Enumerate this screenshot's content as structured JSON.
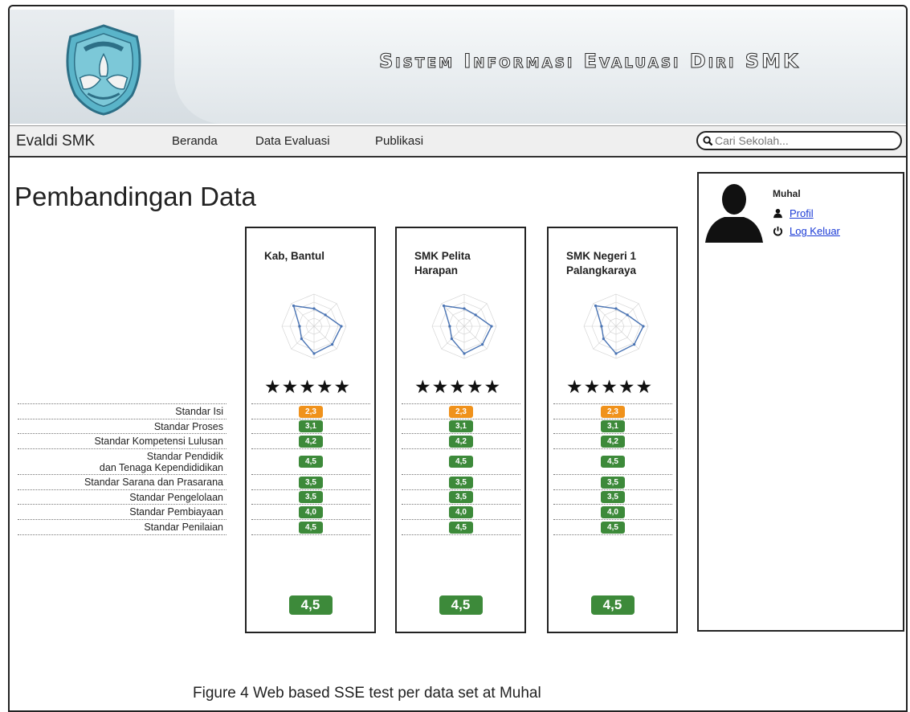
{
  "app": {
    "title": "Sistem Informasi Evaluasi Diri SMK",
    "brand": "Evaldi SMK"
  },
  "nav": {
    "items": [
      "Beranda",
      "Data Evaluasi",
      "Publikasi"
    ],
    "search_placeholder": "Cari Sekolah..."
  },
  "page": {
    "title": "Pembandingan Data"
  },
  "standards": [
    "Standar Isi",
    "Standar Proses",
    "Standar Kompetensi Lulusan",
    "Standar Pendidik\ndan Tenaga Kependididikan",
    "Standar Sarana dan Prasarana",
    "Standar Pengelolaan",
    "Standar Pembiayaan",
    "Standar Penilaian"
  ],
  "colors": {
    "orange": "#f0921c",
    "green": "#3d8a3a"
  },
  "columns": [
    {
      "name": "Kab, Bantul",
      "stars": "★★★★★",
      "scores": [
        "2,3",
        "3,1",
        "4,2",
        "4,5",
        "3,5",
        "3,5",
        "4,0",
        "4,5"
      ],
      "score_colors": [
        "orange",
        "green",
        "green",
        "green",
        "green",
        "green",
        "green",
        "green"
      ],
      "total": "4,5"
    },
    {
      "name": "SMK Pelita Harapan",
      "stars": "★★★★★",
      "scores": [
        "2,3",
        "3,1",
        "4,2",
        "4,5",
        "3,5",
        "3,5",
        "4,0",
        "4,5"
      ],
      "score_colors": [
        "orange",
        "green",
        "green",
        "green",
        "green",
        "green",
        "green",
        "green"
      ],
      "total": "4,5"
    },
    {
      "name": "SMK Negeri 1 Palangkaraya",
      "stars": "★★★★★",
      "scores": [
        "2,3",
        "3,1",
        "4,2",
        "4,5",
        "3,5",
        "3,5",
        "4,0",
        "4,5"
      ],
      "score_colors": [
        "orange",
        "green",
        "green",
        "green",
        "green",
        "green",
        "green",
        "green"
      ],
      "total": "4,5"
    }
  ],
  "user": {
    "name": "Muhal",
    "profile_label": "Profil",
    "logout_label": "Log Keluar"
  },
  "caption": "Figure 4 Web based SSE test per data set at Muhal"
}
